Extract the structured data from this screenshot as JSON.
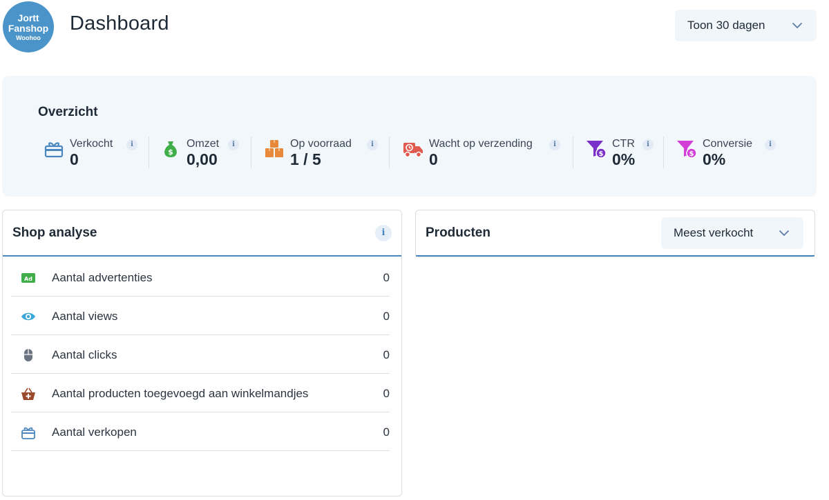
{
  "header": {
    "logo": {
      "line1": "Jortt",
      "line2": "Fanshop",
      "line3": "Woohoo"
    },
    "title": "Dashboard",
    "range_select": "Toon 30 dagen"
  },
  "overview": {
    "title": "Overzicht",
    "info_glyph": "i",
    "stats": [
      {
        "label": "Verkocht",
        "value": "0",
        "icon": "gift-box-icon",
        "color": "#4a86c0"
      },
      {
        "label": "Omzet",
        "value": "0,00",
        "icon": "money-bag-icon",
        "color": "#3fae49"
      },
      {
        "label": "Op voorraad",
        "value": "1 / 5",
        "icon": "boxes-icon",
        "color": "#e8883a"
      },
      {
        "label": "Wacht op verzending",
        "value": "0",
        "icon": "delivery-truck-icon",
        "color": "#e05a4f"
      },
      {
        "label": "CTR",
        "value": "0%",
        "icon": "funnel-dollar-icon",
        "color": "#7a2fc8"
      },
      {
        "label": "Conversie",
        "value": "0%",
        "icon": "funnel-dollar-icon",
        "color": "#d13fd6"
      }
    ]
  },
  "shop_analyse": {
    "title": "Shop analyse",
    "info_glyph": "i",
    "rows": [
      {
        "label": "Aantal advertenties",
        "value": "0",
        "icon": "ad-icon",
        "color": "#3fae49"
      },
      {
        "label": "Aantal views",
        "value": "0",
        "icon": "eye-icon",
        "color": "#3ba6d9"
      },
      {
        "label": "Aantal clicks",
        "value": "0",
        "icon": "mouse-icon",
        "color": "#6b7280"
      },
      {
        "label": "Aantal producten toegevoegd aan winkelmandjes",
        "value": "0",
        "icon": "basket-plus-icon",
        "color": "#9a4a2b"
      },
      {
        "label": "Aantal verkopen",
        "value": "0",
        "icon": "gift-box-icon",
        "color": "#4a86c0"
      }
    ]
  },
  "producten": {
    "title": "Producten",
    "sort_select": "Meest verkocht"
  }
}
